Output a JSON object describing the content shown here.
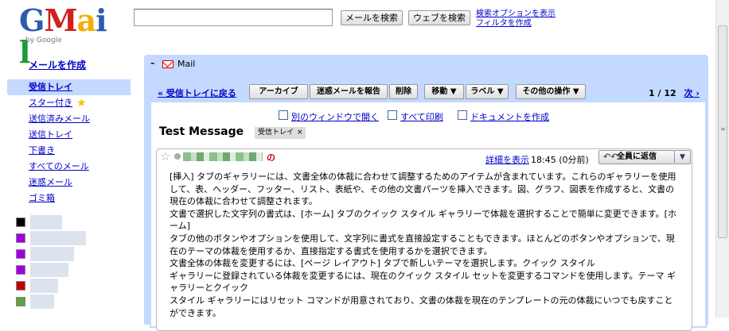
{
  "brand": {
    "logo_text": "Gmail",
    "by_google": "by Google"
  },
  "header": {
    "search_value": "",
    "search_mail_button": "メールを検索",
    "search_web_button": "ウェブを検索",
    "search_options_link": "検索オプションを表示",
    "create_filter_link": "フィルタを作成"
  },
  "sidebar": {
    "compose": "メールを作成",
    "items": [
      {
        "label": "受信トレイ",
        "selected": true
      },
      {
        "label": "スター付き"
      },
      {
        "label": "送信済みメール"
      },
      {
        "label": "送信トレイ"
      },
      {
        "label": "下書き"
      },
      {
        "label": "すべてのメール"
      },
      {
        "label": "迷惑メール"
      },
      {
        "label": "ゴミ箱"
      }
    ],
    "label_colors": [
      "#000000",
      "#a000e0",
      "#a000e0",
      "#a000e0",
      "#c00000",
      "#60a040"
    ]
  },
  "panel": {
    "title": "Mail"
  },
  "toolbar": {
    "back_link": "« 受信トレイに戻る",
    "archive": "アーカイブ",
    "report_spam": "迷惑メールを報告",
    "delete": "削除",
    "move": "移動 ▼",
    "labels": "ラベル ▼",
    "more_actions": "その他の操作 ▼",
    "pager": "1 / 12",
    "next": "次 ›"
  },
  "actions": {
    "open_new_window": "別のウィンドウで開く",
    "print_all": "すべて印刷",
    "create_document": "ドキュメントを作成"
  },
  "message": {
    "subject": "Test Message",
    "tag": "受信トレイ",
    "tag_remove": "×",
    "show_details": "詳細を表示",
    "time": "18:45 (0分前)",
    "reply_all": "全員に返信",
    "reply_menu": "▼",
    "body_lines": [
      "[挿入] タブのギャラリーには、文書全体の体裁に合わせて調整するためのアイテムが含まれています。これらのギャラリーを使用して、表、ヘッダー、フッター、リスト、表紙や、その他の文書パーツを挿入できます。図、グラフ、図表を作成すると、文書の現在の体裁に合わせて調整されます。",
      "文書で選択した文字列の書式は、[ホーム] タブのクイック スタイル ギャラリーで体裁を選択することで簡単に変更できます。[ホーム]",
      "タブの他のボタンやオプションを使用して、文字列に書式を直接設定することもできます。ほとんどのボタンやオプションで、現在のテーマの体裁を使用するか、直接指定する書式を使用するかを選択できます。",
      "文書全体の体裁を変更するには、[ページ レイアウト] タブで新しいテーマを選択します。クイック スタイル",
      "ギャラリーに登録されている体裁を変更するには、現在のクイック スタイル セットを変更するコマンドを使用します。テーマ ギャラリーとクイック",
      "スタイル ギャラリーにはリセット コマンドが用意されており、文書の体裁を現在のテンプレートの元の体裁にいつでも戻すことができます。"
    ]
  }
}
